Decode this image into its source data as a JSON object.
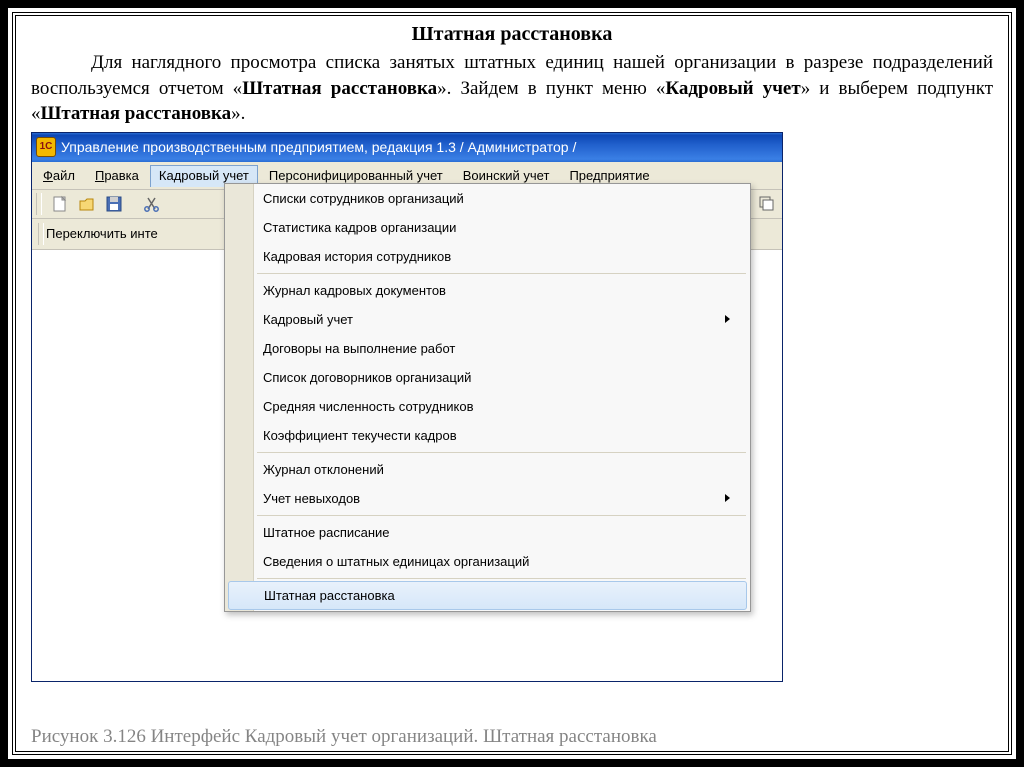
{
  "doc": {
    "title": "Штатная расстановка",
    "para_part1": "Для наглядного просмотра списка занятых штатных единиц нашей организации в разрезе подразделений воспользуемся отчетом «",
    "bold1": "Штатная расстановка",
    "para_part2": "». Зайдем в пункт меню «",
    "bold2": "Кадровый учет",
    "para_part3": "» и выберем подпункт «",
    "bold3": "Штатная расстановка",
    "para_part4": "».",
    "caption": "Рисунок 3.126 Интерфейс Кадровый учет организаций. Штатная расстановка"
  },
  "window": {
    "title": "Управление производственным предприятием, редакция 1.3 / Администратор /",
    "icon_text": "1C"
  },
  "menubar": {
    "file_u": "Ф",
    "file": "айл",
    "edit_u": "П",
    "edit": "равка",
    "hr": "Кадровый учет",
    "pers": "Персонифицированный учет",
    "mil": "Воинский учет",
    "ent": "Предприятие"
  },
  "switch": {
    "label": "Переключить инте"
  },
  "dropdown": {
    "items": [
      {
        "label": "Списки сотрудников организаций",
        "submenu": false
      },
      {
        "label": "Статистика кадров организации",
        "submenu": false
      },
      {
        "label": "Кадровая история сотрудников",
        "submenu": false
      }
    ],
    "group2": [
      {
        "label": "Журнал кадровых документов",
        "submenu": false
      },
      {
        "label": "Кадровый учет",
        "submenu": true
      },
      {
        "label": "Договоры на выполнение работ",
        "submenu": false
      },
      {
        "label": "Список договорников организаций",
        "submenu": false
      },
      {
        "label": "Средняя численность сотрудников",
        "submenu": false
      },
      {
        "label": "Коэффициент текучести кадров",
        "submenu": false
      }
    ],
    "group3": [
      {
        "label": "Журнал отклонений",
        "submenu": false
      },
      {
        "label": "Учет невыходов",
        "submenu": true
      }
    ],
    "group4": [
      {
        "label": "Штатное расписание",
        "submenu": false
      },
      {
        "label": "Сведения о штатных единицах организаций",
        "submenu": false
      }
    ],
    "highlight": {
      "label": "Штатная расстановка"
    }
  }
}
